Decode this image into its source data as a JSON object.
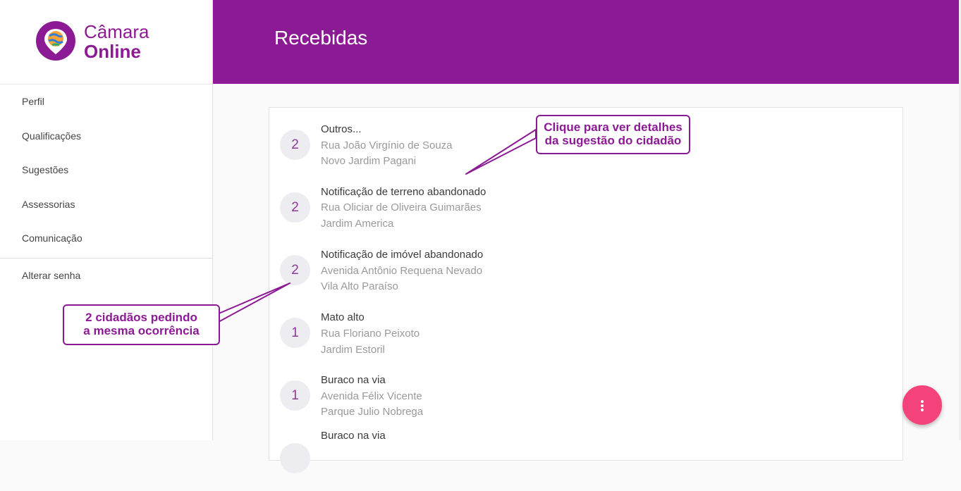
{
  "app": {
    "logo_line1": "Câmara",
    "logo_line2": "Online"
  },
  "sidebar": {
    "items": [
      {
        "label": "Perfil"
      },
      {
        "label": "Qualificações"
      },
      {
        "label": "Sugestões"
      },
      {
        "label": "Assessorias"
      },
      {
        "label": "Comunicação"
      }
    ],
    "secondary_items": [
      {
        "label": "Alterar senha"
      }
    ]
  },
  "header": {
    "title": "Recebidas"
  },
  "list": {
    "items": [
      {
        "count": "2",
        "title": "Outros...",
        "street": "Rua João Virgínio de Souza",
        "district": "Novo Jardim Pagani"
      },
      {
        "count": "2",
        "title": "Notificação de terreno abandonado",
        "street": "Rua Oliciar de Oliveira Guimarães",
        "district": "Jardim America"
      },
      {
        "count": "2",
        "title": "Notificação de imóvel abandonado",
        "street": "Avenida Antônio Requena Nevado",
        "district": "Vila Alto Paraíso"
      },
      {
        "count": "1",
        "title": "Mato alto",
        "street": "Rua Floriano Peixoto",
        "district": "Jardim Estoril"
      },
      {
        "count": "1",
        "title": "Buraco na via",
        "street": "Avenida Félix Vicente",
        "district": "Parque Julio Nobrega"
      },
      {
        "count": "",
        "title": "Buraco na via",
        "street": "",
        "district": ""
      }
    ]
  },
  "annotations": {
    "details_line1": "Clique para ver detalhes",
    "details_line2": "da sugestão do cidadão",
    "same_line1": "2 cidadãos pedindo",
    "same_line2": "a mesma ocorrência"
  },
  "fab": {
    "icon": "more-vertical-icon"
  },
  "colors": {
    "brand": "#8c1a95",
    "fab": "#f4437a",
    "circle": "#ececf1"
  }
}
